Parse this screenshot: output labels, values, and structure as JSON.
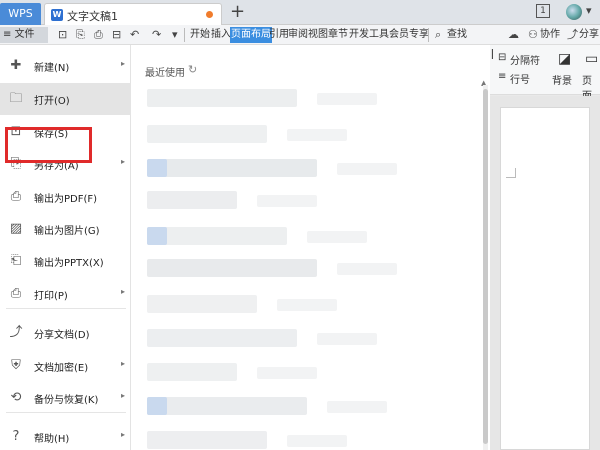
{
  "titlebar": {
    "app_tab": "WPS",
    "doc_tab_icon": "W",
    "doc_tab_title": "文字文稿1",
    "add_tab": "+",
    "right_box": "1"
  },
  "toolbar": {
    "menu_label": "≡ 文件",
    "ribbon_tabs": [
      "开始",
      "插入",
      "页面布局",
      "引用",
      "审阅",
      "视图",
      "章节",
      "开发工具",
      "会员专享"
    ],
    "active_tab": "页面布局",
    "search_label": "查找",
    "collab_label": "协作",
    "share_label": "分享"
  },
  "ribbon": {
    "separator_label": "分隔符",
    "line_number_label": "行号",
    "background_label": "背景",
    "page_border_label": "页面"
  },
  "file_menu": {
    "items": [
      {
        "label": "新建(N)",
        "icon": "new-doc-icon",
        "glyph": "✚",
        "has_arrow": true
      },
      {
        "label": "打开(O)",
        "icon": "folder-open-icon",
        "glyph": "🗀",
        "has_arrow": false
      },
      {
        "label": "保存(S)",
        "icon": "save-icon",
        "glyph": "⊡",
        "has_arrow": false
      },
      {
        "label": "另存为(A)",
        "icon": "save-as-icon",
        "glyph": "⎘",
        "has_arrow": true
      },
      {
        "label": "输出为PDF(F)",
        "icon": "pdf-icon",
        "glyph": "⎙",
        "has_arrow": false
      },
      {
        "label": "输出为图片(G)",
        "icon": "image-icon",
        "glyph": "▨",
        "has_arrow": false
      },
      {
        "label": "输出为PPTX(X)",
        "icon": "pptx-icon",
        "glyph": "⎗",
        "has_arrow": false
      },
      {
        "label": "打印(P)",
        "icon": "print-icon",
        "glyph": "⎙",
        "has_arrow": true
      },
      {
        "label": "分享文档(D)",
        "icon": "share-icon",
        "glyph": "⤴",
        "has_arrow": false
      },
      {
        "label": "文档加密(E)",
        "icon": "lock-icon",
        "glyph": "⛨",
        "has_arrow": true
      },
      {
        "label": "备份与恢复(K)",
        "icon": "backup-icon",
        "glyph": "⟲",
        "has_arrow": true
      },
      {
        "label": "帮助(H)",
        "icon": "help-icon",
        "glyph": "?",
        "has_arrow": true
      }
    ],
    "highlighted": "打开(O)",
    "arrow_glyph": "▸"
  },
  "recent": {
    "title": "最近使用",
    "refresh_glyph": "↻"
  },
  "colors": {
    "accent": "#3b8ee0",
    "wps_tab": "#4a8bd8",
    "highlight_box": "#e02a2a",
    "unsaved_dot": "#f07c2c"
  }
}
